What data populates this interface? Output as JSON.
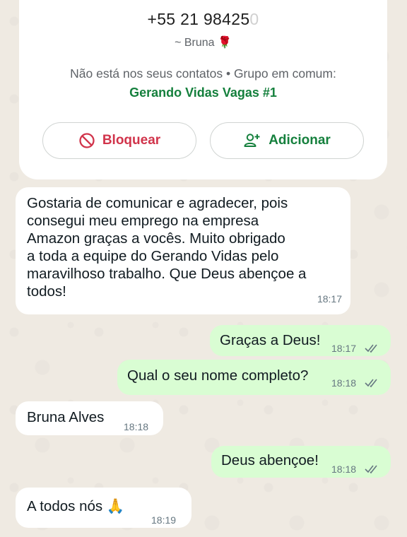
{
  "contact_card": {
    "phone": "+55 21 98425",
    "phone_faded": "0",
    "alias": "~ Bruna",
    "alias_emoji": "🌹",
    "not_in_contacts": "Não está nos seus contatos • Grupo em comum:",
    "common_group": "Gerando Vidas Vagas #1",
    "block_label": "Bloquear",
    "add_label": "Adicionar"
  },
  "messages": [
    {
      "direction": "in",
      "text": "Gostaria de comunicar e agradecer, pois\nconsegui meu emprego na empresa\nAmazon graças a vocês. Muito obrigado\na toda a equipe do Gerando Vidas pelo\nmaravilhoso trabalho. Que Deus abençoe a\ntodos!",
      "time": "18:17"
    },
    {
      "direction": "out",
      "text": "Graças a Deus!",
      "time": "18:17",
      "status": "read"
    },
    {
      "direction": "out",
      "text": "Qual o seu nome completo?",
      "time": "18:18",
      "status": "read"
    },
    {
      "direction": "in",
      "text": "Bruna Alves",
      "time": "18:18"
    },
    {
      "direction": "out",
      "text": "Deus abençoe!",
      "time": "18:18",
      "status": "read"
    },
    {
      "direction": "in",
      "text": "A todos nós",
      "emoji": "🙏",
      "time": "18:19"
    }
  ],
  "colors": {
    "chat_background": "#efeae2",
    "incoming_bubble": "#ffffff",
    "outgoing_bubble": "#d9fdd3",
    "accent_green": "#15803d",
    "block_red": "#d1344b",
    "read_ticks": "#667781"
  },
  "icons": {
    "block": "block-icon",
    "add": "add-contact-icon",
    "ticks": "double-check-icon"
  }
}
